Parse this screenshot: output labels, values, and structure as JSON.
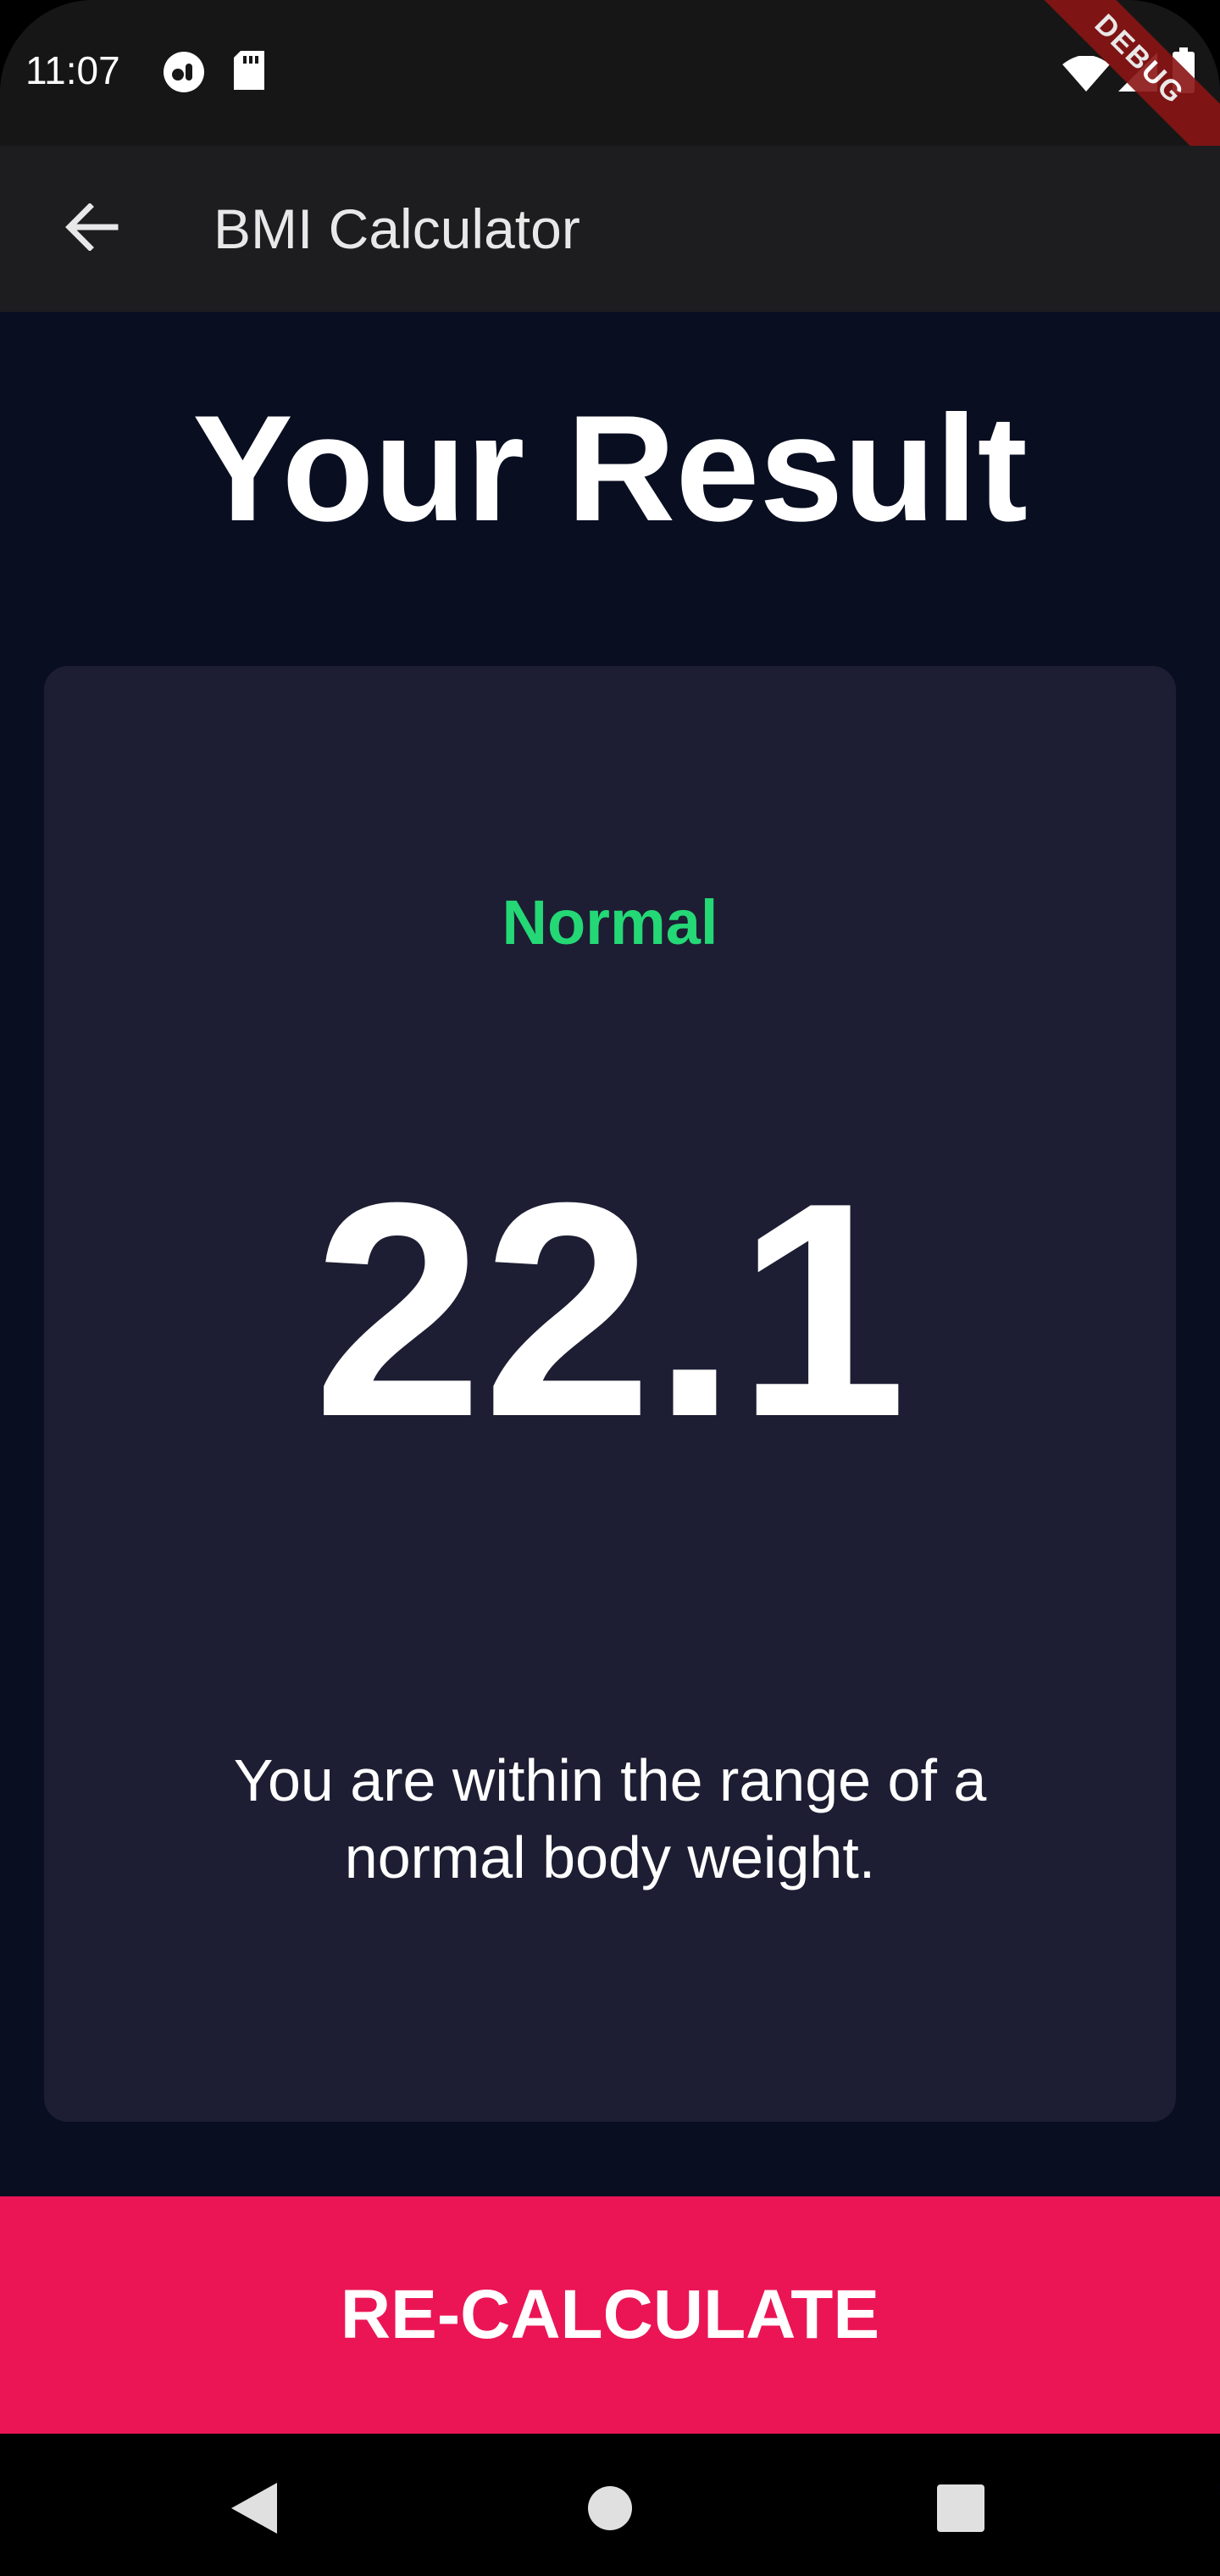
{
  "status_bar": {
    "time": "11:07",
    "left_icons": [
      "incognito-icon",
      "sd-card-icon"
    ],
    "right_icons": [
      "wifi-icon",
      "cell-signal-icon",
      "battery-icon"
    ]
  },
  "debug_banner": "DEBUG",
  "app_bar": {
    "title": "BMI Calculator",
    "back_icon": "arrow-back-icon"
  },
  "page": {
    "title": "Your Result"
  },
  "result": {
    "status": "Normal",
    "bmi": "22.1",
    "advice": "You are within the range of a normal body weight."
  },
  "action": {
    "label": "RE-CALCULATE"
  },
  "nav_bar": {
    "buttons": [
      "back-triangle-icon",
      "home-circle-icon",
      "recents-square-icon"
    ]
  },
  "colors": {
    "background": "#090E21",
    "card": "#1D1E33",
    "status_text": "#24D876",
    "button": "#EB1555",
    "appbar": "#1D1D1F"
  }
}
